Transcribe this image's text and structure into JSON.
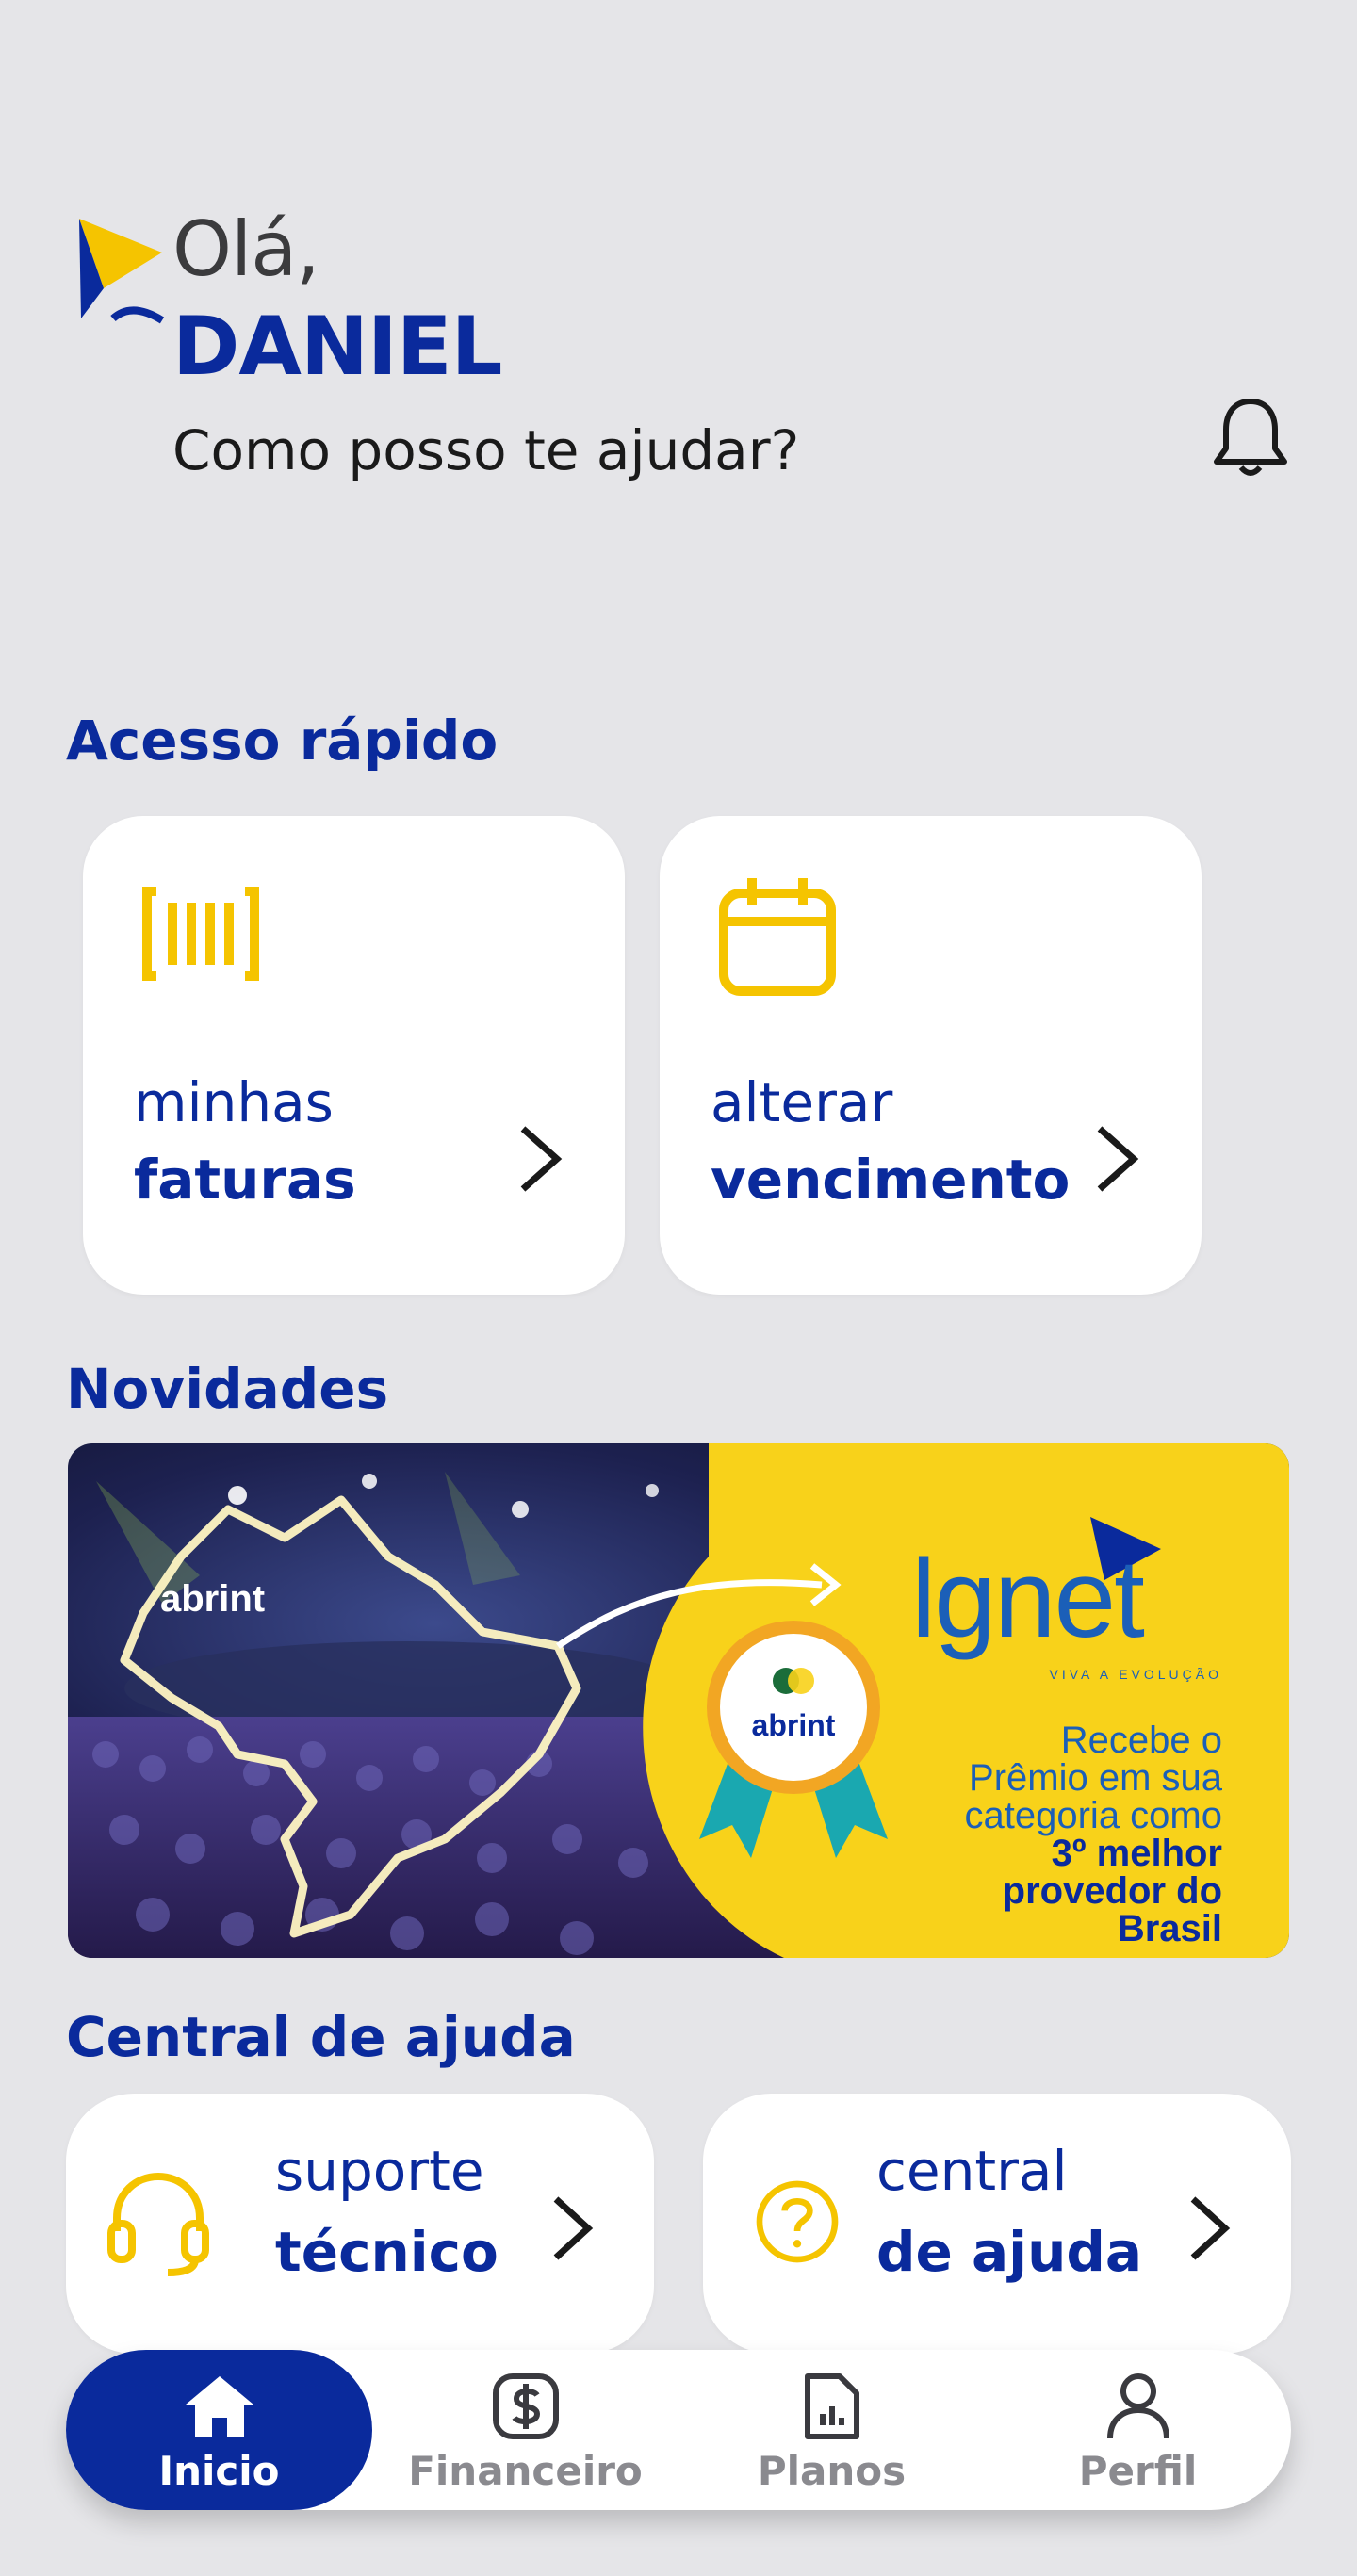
{
  "header": {
    "greeting": "Olá,",
    "user_name": "DANIEL",
    "question": "Como posso te ajudar?"
  },
  "quick_access": {
    "title": "Acesso rápido",
    "cards": [
      {
        "line1": "minhas",
        "line2": "faturas",
        "icon": "barcode-icon"
      },
      {
        "line1": "alterar",
        "line2": "vencimento",
        "icon": "calendar-icon"
      }
    ]
  },
  "news": {
    "title": "Novidades",
    "banner": {
      "event_logo": "abrint",
      "brand": "lgnet",
      "brand_tagline": "VIVA A EVOLUÇÃO",
      "badge_text": "abrint",
      "message_lines": [
        "Recebe o",
        "Prêmio em sua",
        "categoria como"
      ],
      "highlight_lines": [
        "3º melhor",
        "provedor do",
        "Brasil"
      ]
    }
  },
  "help_center": {
    "title": "Central de ajuda",
    "cards": [
      {
        "line1": "suporte",
        "line2": "técnico",
        "icon": "headset-icon"
      },
      {
        "line1": "central",
        "line2": "de ajuda",
        "icon": "help-circle-icon"
      }
    ]
  },
  "bottom_nav": {
    "items": [
      {
        "label": "Inicio",
        "icon": "home-icon",
        "active": true
      },
      {
        "label": "Financeiro",
        "icon": "dollar-icon",
        "active": false
      },
      {
        "label": "Planos",
        "icon": "document-chart-icon",
        "active": false
      },
      {
        "label": "Perfil",
        "icon": "user-icon",
        "active": false
      }
    ]
  },
  "colors": {
    "primary": "#0a2a9c",
    "accent": "#f5c400",
    "background": "#e5e5e8"
  }
}
